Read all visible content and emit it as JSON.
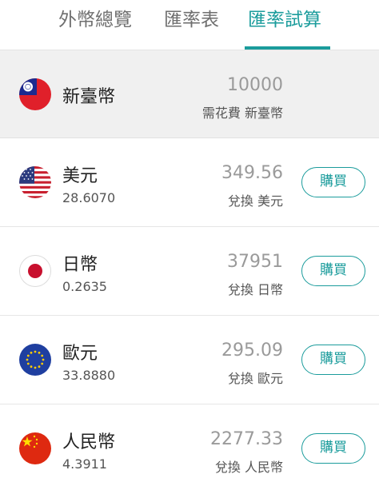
{
  "tabs": [
    {
      "label": "外幣總覽",
      "active": false
    },
    {
      "label": "匯率表",
      "active": false
    },
    {
      "label": "匯率試算",
      "active": true
    }
  ],
  "colors": {
    "accent": "#1b9c9c",
    "amount": "#9a9a9a"
  },
  "base": {
    "flag": "taiwan-flag-icon",
    "name": "新臺幣",
    "amount": "10000",
    "amount_label": "需花費 新臺幣"
  },
  "currencies": [
    {
      "flag": "us-flag-icon",
      "name": "美元",
      "rate": "28.6070",
      "amount": "349.56",
      "amount_label": "兌換 美元",
      "button": "購買"
    },
    {
      "flag": "japan-flag-icon",
      "name": "日幣",
      "rate": "0.2635",
      "amount": "37951",
      "amount_label": "兌換 日幣",
      "button": "購買"
    },
    {
      "flag": "eu-flag-icon",
      "name": "歐元",
      "rate": "33.8880",
      "amount": "295.09",
      "amount_label": "兌換 歐元",
      "button": "購買"
    },
    {
      "flag": "china-flag-icon",
      "name": "人民幣",
      "rate": "4.3911",
      "amount": "2277.33",
      "amount_label": "兌換 人民幣",
      "button": "購買"
    }
  ]
}
